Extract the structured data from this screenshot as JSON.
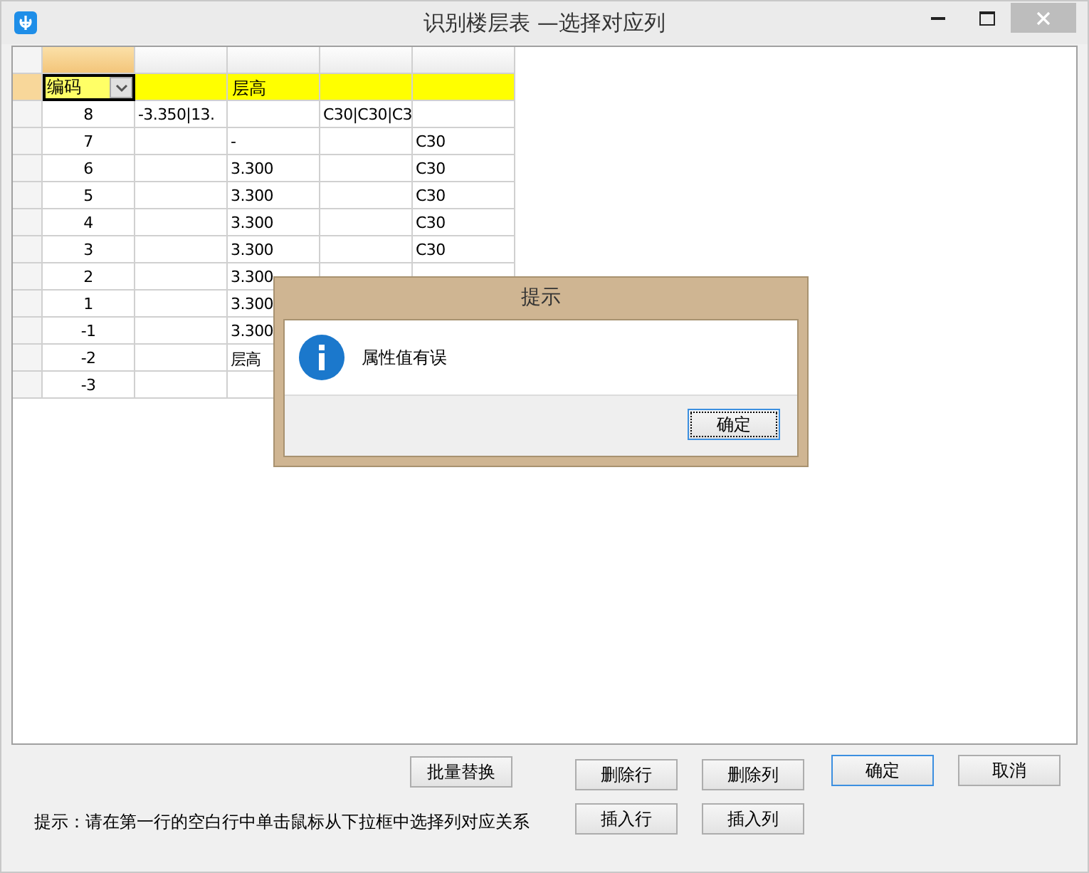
{
  "window": {
    "title": "识别楼层表 —选择对应列"
  },
  "table": {
    "columns": [
      {
        "selected": true
      },
      {
        "selected": false
      },
      {
        "selected": false
      },
      {
        "selected": false
      },
      {
        "selected": false
      }
    ],
    "mapping_row": {
      "selected": true,
      "cells": [
        {
          "kind": "dropdown",
          "text": "编码"
        },
        {
          "kind": "plain",
          "text": ""
        },
        {
          "kind": "plain",
          "text": "层高"
        },
        {
          "kind": "plain",
          "text": ""
        },
        {
          "kind": "plain",
          "text": ""
        }
      ]
    },
    "rows": [
      [
        "8",
        "-3.350|13.",
        "",
        "C30|C30|C3",
        ""
      ],
      [
        "7",
        "",
        "-",
        "",
        "C30"
      ],
      [
        "6",
        "",
        "3.300",
        "",
        "C30"
      ],
      [
        "5",
        "",
        "3.300",
        "",
        "C30"
      ],
      [
        "4",
        "",
        "3.300",
        "",
        "C30"
      ],
      [
        "3",
        "",
        "3.300",
        "",
        "C30"
      ],
      [
        "2",
        "",
        "3.300",
        "",
        ""
      ],
      [
        "1",
        "",
        "3.300",
        "",
        ""
      ],
      [
        "-1",
        "",
        "3.300",
        "",
        ""
      ],
      [
        "-2",
        "",
        "层高",
        "",
        ""
      ],
      [
        "-3",
        "",
        "",
        "",
        ""
      ]
    ]
  },
  "buttons": [
    {
      "label": "批量替换",
      "focused": false
    },
    {
      "label": "删除行",
      "focused": false
    },
    {
      "label": "删除列",
      "focused": false
    },
    {
      "label": "确定",
      "focused": true
    },
    {
      "label": "取消",
      "focused": false
    },
    {
      "label": "插入行",
      "focused": false
    },
    {
      "label": "插入列",
      "focused": false
    }
  ],
  "hint": "提示：请在第一行的空白行中单击鼠标从下拉框中选择列对应关系",
  "dialog": {
    "title": "提示",
    "message": "属性值有误",
    "button": {
      "label": "确定",
      "focused": true
    }
  }
}
